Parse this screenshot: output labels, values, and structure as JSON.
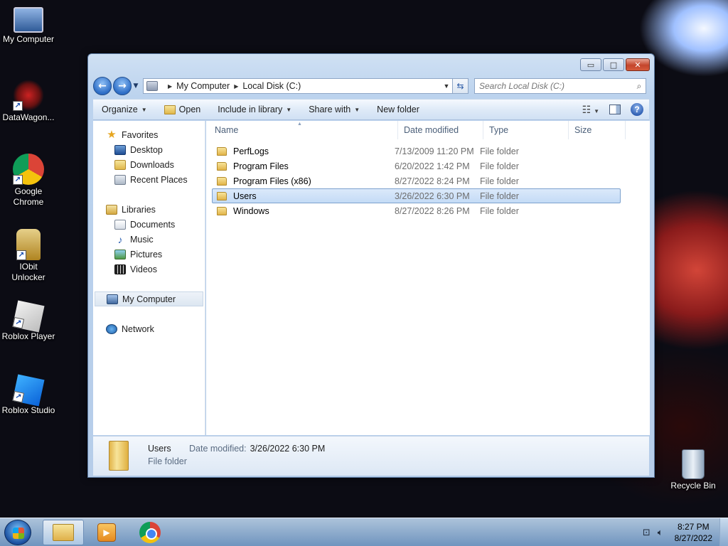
{
  "desktop": {
    "icons": [
      {
        "label": "My Computer"
      },
      {
        "label": "DataWagon..."
      },
      {
        "label": "Google Chrome"
      },
      {
        "label": "IObit Unlocker"
      },
      {
        "label": "Roblox Player"
      },
      {
        "label": "Roblox Studio"
      },
      {
        "label": "Recycle Bin"
      }
    ]
  },
  "window": {
    "caption_buttons": {
      "minimize": "▭",
      "maximize": "□",
      "close": "✕"
    },
    "address": {
      "breadcrumbs": [
        "My Computer",
        "Local Disk (C:)"
      ],
      "search_placeholder": "Search Local Disk (C:)"
    },
    "toolbar": {
      "organize": "Organize",
      "open": "Open",
      "include_in_library": "Include in library",
      "share_with": "Share with",
      "new_folder": "New folder"
    },
    "nav_pane": {
      "favorites": {
        "label": "Favorites",
        "items": [
          "Desktop",
          "Downloads",
          "Recent Places"
        ]
      },
      "libraries": {
        "label": "Libraries",
        "items": [
          "Documents",
          "Music",
          "Pictures",
          "Videos"
        ]
      },
      "computer": "My Computer",
      "network": "Network"
    },
    "columns": {
      "name": "Name",
      "date": "Date modified",
      "type": "Type",
      "size": "Size"
    },
    "files": [
      {
        "name": "PerfLogs",
        "date": "7/13/2009 11:20 PM",
        "type": "File folder"
      },
      {
        "name": "Program Files",
        "date": "6/20/2022 1:42 PM",
        "type": "File folder"
      },
      {
        "name": "Program Files (x86)",
        "date": "8/27/2022 8:24 PM",
        "type": "File folder"
      },
      {
        "name": "Users",
        "date": "3/26/2022 6:30 PM",
        "type": "File folder",
        "selected": true
      },
      {
        "name": "Windows",
        "date": "8/27/2022 8:26 PM",
        "type": "File folder"
      }
    ],
    "details": {
      "name": "Users",
      "type": "File folder",
      "modified_label": "Date modified:",
      "modified_value": "3/26/2022 6:30 PM"
    }
  },
  "taskbar": {
    "clock_time": "8:27 PM",
    "clock_date": "8/27/2022"
  },
  "colors": {
    "selection": "#c4dbf6",
    "selection_border": "#7da2ce",
    "toolbar": "#dde9f7"
  }
}
